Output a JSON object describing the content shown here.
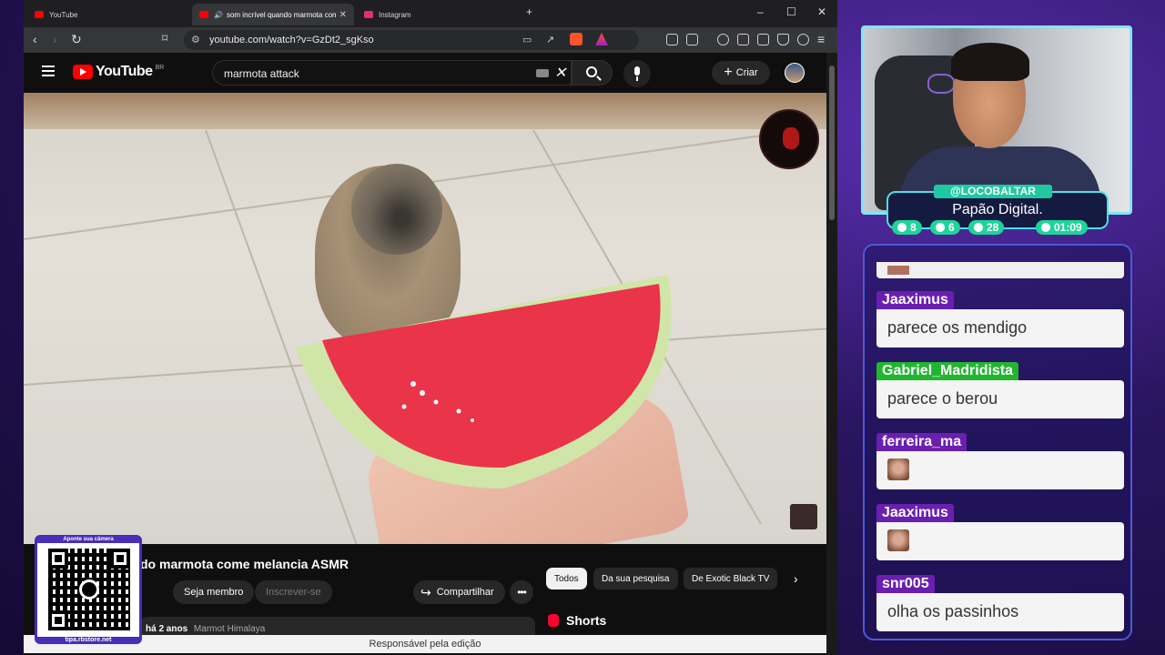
{
  "browser": {
    "tabs": [
      {
        "title": "YouTube",
        "fav_color": "#ff0000"
      },
      {
        "title": "som incrível quando marmota come...",
        "fav_color": "#ff0000"
      },
      {
        "title": "Instagram",
        "fav_color": "#e1306c"
      }
    ],
    "url": "youtube.com/watch?v=GzDt2_sgKso"
  },
  "youtube": {
    "logo_text": "YouTube",
    "country": "BR",
    "search_value": "marmota attack",
    "create_label": "Criar",
    "video_title": "do marmota come melancia ASMR",
    "join_label": "Seja membro",
    "subscribe_label": "Inscrever-se",
    "share_label": "Compartilhar",
    "more_label": "•••",
    "chips": [
      "Todos",
      "Da sua pesquisa",
      "De Exotic Black TV"
    ],
    "shorts_label": "Shorts",
    "upload_age": "há 2 anos",
    "tag": "Marmot Himalaya",
    "status_text": "Responsável pela edição",
    "brand_color": "#ff0000"
  },
  "qr": {
    "caption": "Aponte sua câmera",
    "footer": "tipa.rbstore.net"
  },
  "stream": {
    "handle": "@LOCOBALTAR",
    "subtitle": "Papão Digital.",
    "stats": [
      {
        "icon": "twitch-icon",
        "value": "8"
      },
      {
        "icon": "youtube-icon",
        "value": "6"
      },
      {
        "icon": "kick-icon",
        "value": "28"
      },
      {
        "icon": "clock-icon",
        "value": "01:09"
      }
    ],
    "accent_color": "#4ae0e8"
  },
  "chat": {
    "messages": [
      {
        "user": "Jaaximus",
        "text": "parece os mendigo",
        "user_color": "#6a1fb0"
      },
      {
        "user": "Gabriel_Madridista",
        "text": "parece o berou",
        "user_color": "#22b530"
      },
      {
        "user": "ferreira_ma",
        "text": "",
        "user_color": "#6a1fb0"
      },
      {
        "user": "Jaaximus",
        "text": "",
        "user_color": "#6a1fb0"
      },
      {
        "user": "snr005",
        "text": "olha os passinhos",
        "user_color": "#6a1fb0"
      }
    ]
  }
}
